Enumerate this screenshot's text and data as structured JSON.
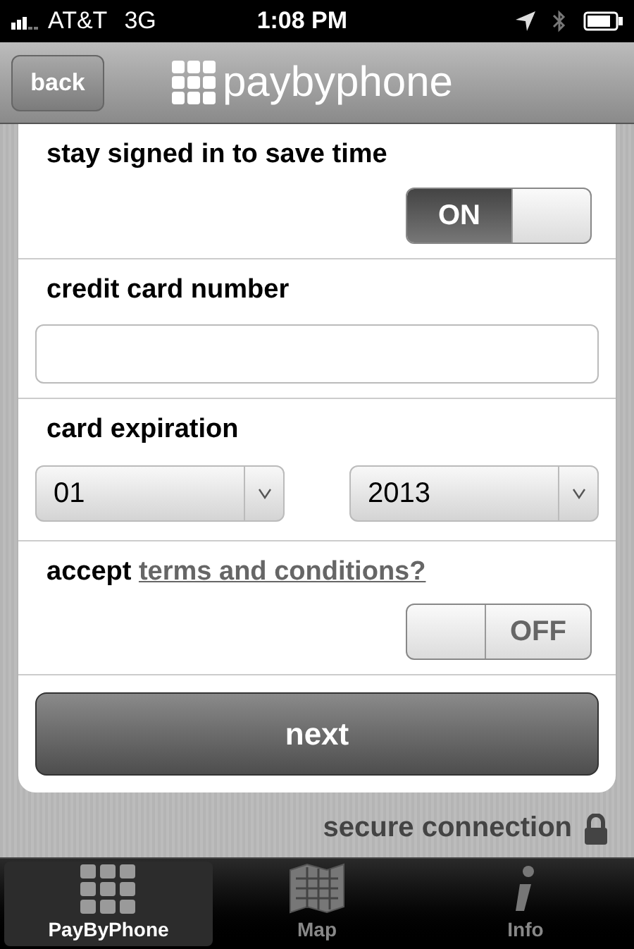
{
  "status_bar": {
    "carrier": "AT&T",
    "network": "3G",
    "time": "1:08 PM"
  },
  "nav_bar": {
    "back": "back",
    "logo_text": "paybyphone"
  },
  "form": {
    "sections": [
      {
        "kind": "toggle",
        "label": "stay signed in to save time",
        "switch": {
          "on": true,
          "text": "ON"
        }
      },
      {
        "kind": "field",
        "label": "credit card number"
      },
      {
        "kind": "selects",
        "label": "card expiration",
        "selects": [
          {
            "value": "01"
          },
          {
            "value": "2013"
          }
        ]
      },
      {
        "kind": "toggle",
        "label": "accept",
        "link": "terms and conditions?",
        "switch": {
          "on": false,
          "text": "OFF"
        }
      }
    ],
    "next_button": "next"
  },
  "secure_note": "secure connection",
  "tab_bar": [
    {
      "label": "PayByPhone",
      "selected": true,
      "kind": "grid"
    },
    {
      "label": "Map",
      "selected": false,
      "kind": "map"
    },
    {
      "label": "Info",
      "selected": false,
      "kind": "info"
    }
  ]
}
